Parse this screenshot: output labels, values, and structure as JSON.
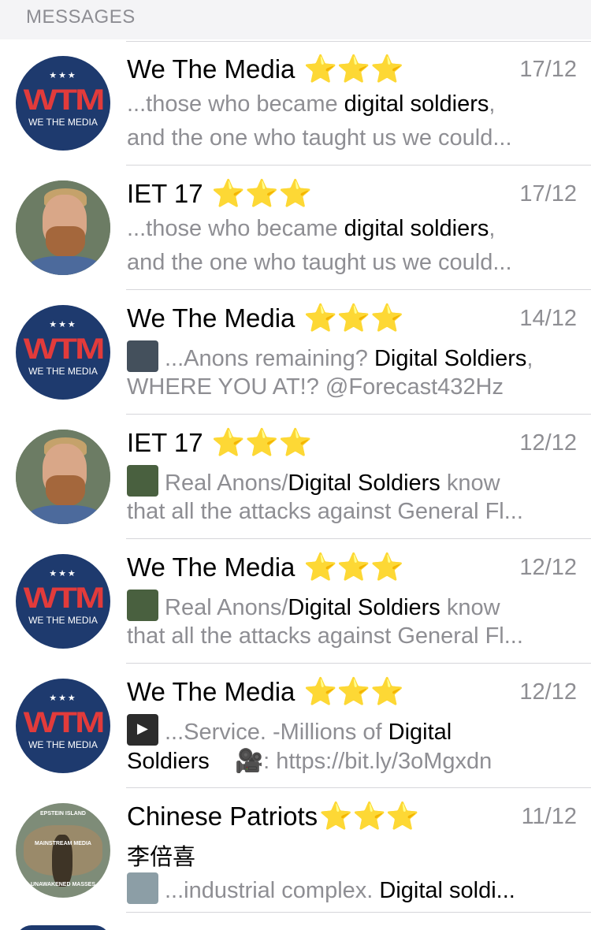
{
  "section_header": "MESSAGES",
  "stars": "⭐⭐⭐",
  "avatar_wtm": {
    "stars": "★★★",
    "logo": "WTM",
    "subtitle": "WE THE MEDIA"
  },
  "avatar_map": {
    "top": "EPSTEIN ISLAND",
    "mid": "MAINSTREAM MEDIA",
    "bottom": "UNAWAKENED MASSES"
  },
  "rows": [
    {
      "name": "We The Media",
      "date": "17/12",
      "l1_pre": "...those who became ",
      "l1_hl": "digital soldiers",
      "l1_post": ",",
      "l2": "and the one who taught us we could..."
    },
    {
      "name": "IET 17",
      "date": "17/12",
      "l1_pre": "...those who became ",
      "l1_hl": "digital soldiers",
      "l1_post": ",",
      "l2": "and the one who taught us we could..."
    },
    {
      "name": "We The Media",
      "date": "14/12",
      "l1_pre": "...Anons remaining? ",
      "l1_hl": "Digital Soldiers",
      "l1_post": ",",
      "l2": "WHERE YOU AT!? @Forecast432Hz"
    },
    {
      "name": "IET 17",
      "date": "12/12",
      "l1_pre": "Real Anons/",
      "l1_hl": "Digital Soldiers",
      "l1_post": " know",
      "l2": "that all the attacks against General Fl..."
    },
    {
      "name": "We The Media",
      "date": "12/12",
      "l1_pre": "Real Anons/",
      "l1_hl": "Digital Soldiers",
      "l1_post": " know",
      "l2": "that all the attacks against General Fl..."
    },
    {
      "name": "We The Media",
      "date": "12/12",
      "l1_pre": "...Service. -Millions of ",
      "l1_hl": "Digital",
      "l1_post": "",
      "l2_hl": "Soldiers",
      "l2_cam": "🎥",
      "l2": ": https://bit.ly/3oMgxdn"
    },
    {
      "name": "Chinese Patriots",
      "date": "11/12",
      "l1_hl": "李倍喜",
      "l2_pre": "...industrial complex.  ",
      "l2_hl": "Digital soldi..."
    }
  ]
}
